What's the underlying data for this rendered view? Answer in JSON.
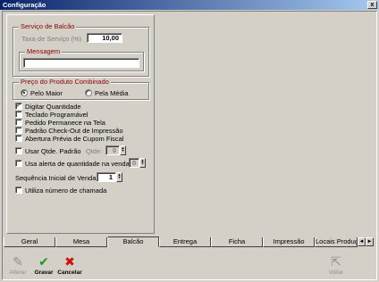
{
  "window": {
    "title": "Configuração",
    "close_glyph": "x"
  },
  "servico_balcao": {
    "title": "Serviço de Balcão",
    "taxa_label": "Taxa de Serviço (%)",
    "taxa_value": "10,00",
    "mensagem_title": "Mensagem",
    "mensagem_value": ""
  },
  "preco_combinado": {
    "title": "Preço do Produto Combinado",
    "options": [
      {
        "label": "Pelo Maior",
        "selected": true
      },
      {
        "label": "Pela Média",
        "selected": false
      }
    ]
  },
  "options": {
    "digitar_quantidade": {
      "label": "Digitar Quantidade",
      "checked": true,
      "mark": "✓"
    },
    "teclado_programavel": {
      "label": "Teclado Programável",
      "checked": false
    },
    "pedido_permanece": {
      "label": "Pedido Permanece na Tela",
      "checked": false
    },
    "padrao_checkout": {
      "label": "Padrão Check-Out de Impressão",
      "checked": false
    },
    "abertura_previa": {
      "label": "Abertura Prévia de Cupom Fiscal",
      "checked": false
    },
    "usar_qtde_padrao": {
      "label": "Usar Qtde. Padrão",
      "checked": false
    },
    "qtde_label": "Qtde:",
    "qtde_value": "0",
    "usa_alerta": {
      "label": "Usa alerta de quantidade na venda",
      "checked": false
    },
    "alerta_value": "0",
    "sequencia_label": "Sequência Inicial de Venda:",
    "sequencia_value": "1",
    "utiliza_numero": {
      "label": "Utiliza número de chamada",
      "checked": false
    }
  },
  "tabs": [
    {
      "label": "Geral",
      "active": false
    },
    {
      "label": "Mesa",
      "active": false
    },
    {
      "label": "Balcão",
      "active": true
    },
    {
      "label": "Entrega",
      "active": false
    },
    {
      "label": "Ficha",
      "active": false
    },
    {
      "label": "Impressão",
      "active": false
    },
    {
      "label": "Locais Produç",
      "active": false
    }
  ],
  "tab_scroll": {
    "left": "◄",
    "right": "►"
  },
  "toolbar": {
    "alterar": {
      "label": "Alterar",
      "icon": "edit-icon",
      "glyph": "✎",
      "enabled": false
    },
    "gravar": {
      "label": "Gravar",
      "icon": "check-icon",
      "glyph": "✔",
      "enabled": true,
      "color": "#1a9a1a"
    },
    "cancelar": {
      "label": "Cancelar",
      "icon": "cancel-icon",
      "glyph": "✖",
      "enabled": true,
      "color": "#cc1111"
    },
    "voltar": {
      "label": "Voltar",
      "icon": "back-icon",
      "glyph": "⇱",
      "enabled": false
    }
  },
  "colors": {
    "face": "#d4d0c8",
    "group_title": "#8b0000",
    "title_start": "#0a246a",
    "title_end": "#a6caf0"
  }
}
